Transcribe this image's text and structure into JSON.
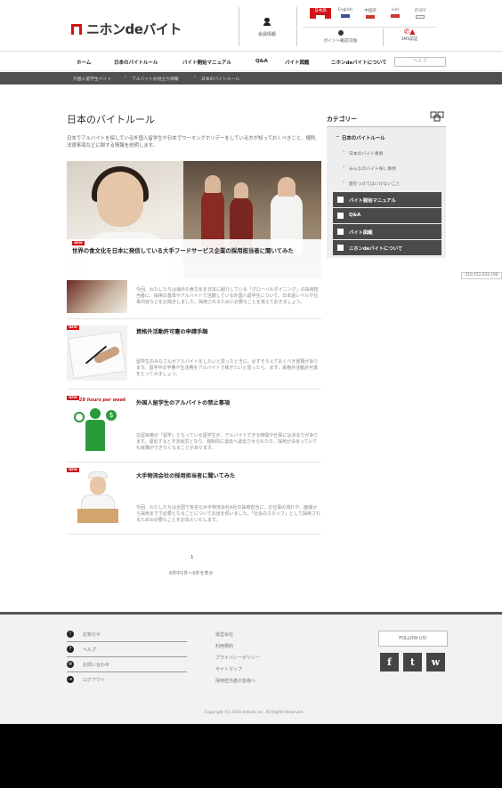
{
  "header": {
    "logo_text": "ニホンdeバイト",
    "member_label": "会員情報",
    "languages": [
      {
        "label": "日本語",
        "active": true
      },
      {
        "label": "English",
        "active": false
      },
      {
        "label": "中国語",
        "active": false
      },
      {
        "label": "viet",
        "active": false
      },
      {
        "label": "한국어",
        "active": false
      }
    ],
    "points_label": "ポイント確認/交換",
    "sms_label": "SMS認証",
    "accent_color": "#d01418"
  },
  "nav": {
    "items": [
      "ホーム",
      "日本のバイトルール",
      "バイト開始マニュアル",
      "Q&A",
      "バイト図鑑",
      "ニホンdeバイトについて"
    ],
    "help_label": "ヘルプ"
  },
  "breadcrumb": [
    "外国人留学生バイト",
    "アルバイトお役立ち情報",
    "日本のバイトルール"
  ],
  "main": {
    "title": "日本のバイトルール",
    "intro": "日本でアルバイトを探している外国人留学生や日本でワーキングホリデーをしている方が知っておくべきこと、規則、法律事項などに関する情報を説明します。",
    "new_label": "NEW",
    "hero": {
      "title": "世界の食文化を日本に発信している大手フードサービス企業の採用担当者に聞いてみた",
      "desc": "今回、わたしたちは海外の食文化を日本に紹介している「グローバルダイニング」の採用担当者に、採用の基準やアルバイトで活躍している外国人留学生について、日本語レベルや仕事内容などをお聞きしました。採用されるために必要なことを覚えておきましょう。"
    },
    "articles": [
      {
        "title": "資格外活動許可書の申請手順",
        "desc": "留学生のみなさんがアルバイトをしたいと思ったときに、必ずそろえておくべき書類があります。留学中の学費や生活費をアルバイトで稼ぎたいと思ったら、まず、資格外活動許可書をとってみましょう。"
      },
      {
        "title": "外国人留学生のアルバイトの禁止事項",
        "desc": "在留資格が「留学」となっている留学生が、アルバイトできる時間や仕事には決まりがあります。違反すると不法就労となり、強制的に退去へ退去させられたり、採用が決まっていても就職ができなくなることがあります。",
        "badge_text": "28 hours per week"
      },
      {
        "title": "大手物流会社の採用担当者に聞いてみた",
        "desc": "今回、わたしたちは全国で有名な大手物流会社A社の採用担当に、お仕事の流れや、面接から採用までで必要となることについてお話を伺いました。「社会のスタッフ」として採用されるための必要なことをお伝えいたします。"
      }
    ],
    "page_number": "1",
    "page_count": "6件中1件〜6件を表示"
  },
  "sidebar": {
    "title": "カテゴリー",
    "main_item": "日本のバイトルール",
    "sub_items": [
      "日本のバイト事情",
      "みんなのバイト探し事情",
      "面をつけてはいけないこと"
    ],
    "sections": [
      "バイト開始マニュアル",
      "Q&A",
      "バイト図鑑",
      "ニホンdeバイトについて"
    ]
  },
  "ip_address": "210.152.243.196",
  "footer": {
    "items": [
      {
        "icon": "!",
        "label": "お知らせ"
      },
      {
        "icon": "?",
        "label": "ヘルプ"
      },
      {
        "icon": "✉",
        "label": "お問い合わせ"
      },
      {
        "icon": "⇥",
        "label": "ログアウト"
      }
    ],
    "links": [
      "運営会社",
      "利用規約",
      "プライバシーポリシー",
      "サイトマップ",
      "採用担当者の皆様へ"
    ],
    "follow_label": "FOLLOW US!",
    "social": [
      "f",
      "t",
      "w"
    ],
    "copyright": "Copyright (C) 2016 Indival, Inc. All Rights Reserved."
  }
}
